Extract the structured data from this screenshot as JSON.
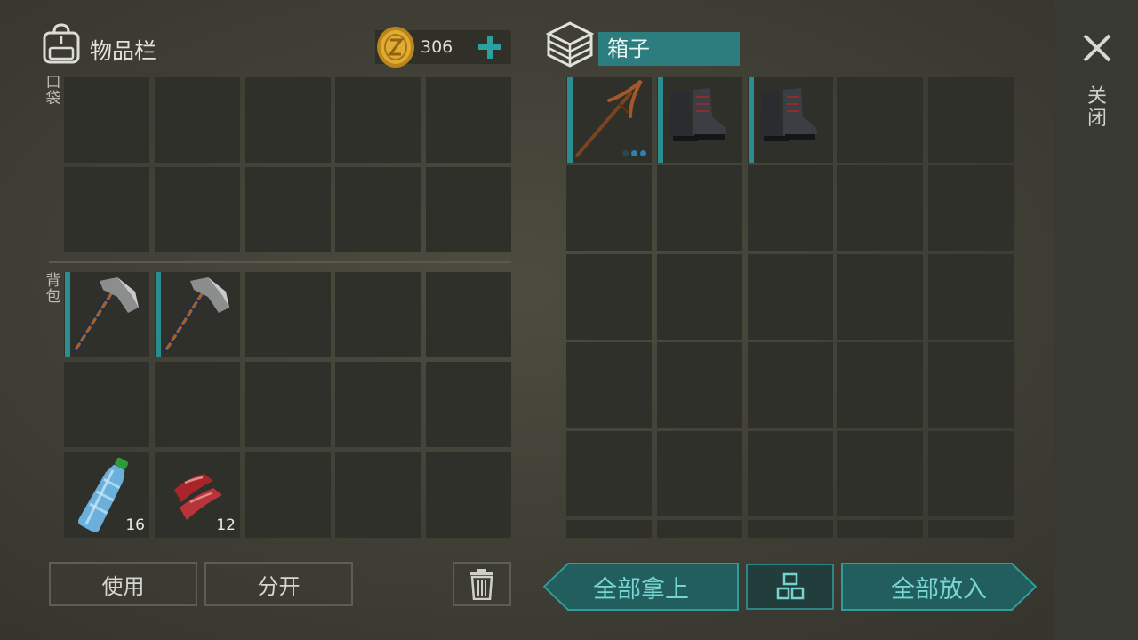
{
  "inventory": {
    "title": "物品栏",
    "coins": "306",
    "pocket_label": "口袋",
    "backpack_label": "背包",
    "backpack_items": [
      {
        "name": "hatchet"
      },
      {
        "name": "hatchet"
      },
      {
        "name": "water-bottle",
        "count": "16"
      },
      {
        "name": "raw-meat",
        "count": "12"
      }
    ]
  },
  "box": {
    "title": "箱子",
    "items": [
      {
        "name": "pickaxe"
      },
      {
        "name": "boots"
      },
      {
        "name": "boots"
      }
    ]
  },
  "buttons": {
    "use": "使用",
    "split": "分开",
    "take_all": "全部拿上",
    "put_all": "全部放入",
    "close": "关闭"
  },
  "colors": {
    "accent": "#2c7d7d",
    "slot": "#2f302a",
    "button_text": "#77d6d3"
  }
}
